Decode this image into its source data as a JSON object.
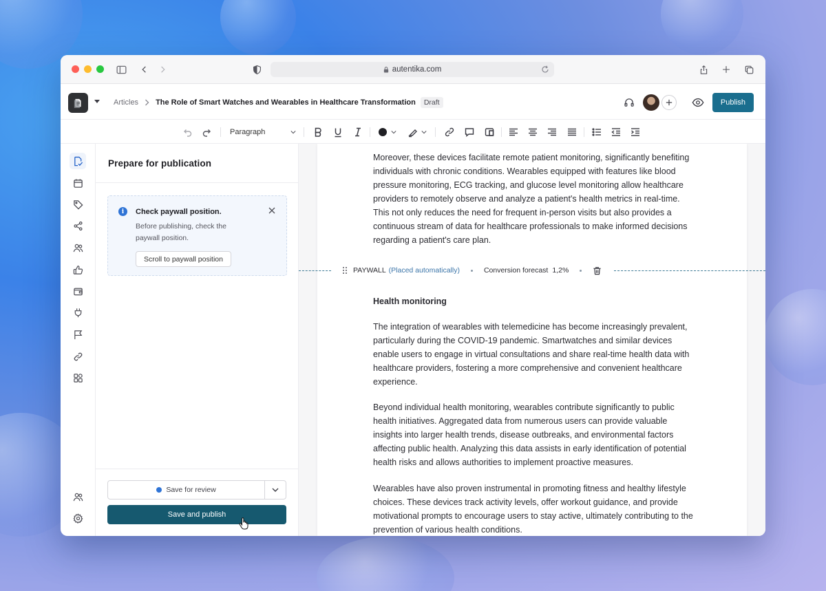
{
  "browser": {
    "url": "autentika.com"
  },
  "header": {
    "breadcrumb_parent": "Articles",
    "article_title": "The Role of Smart Watches and Wearables in Healthcare Transformation",
    "status_badge": "Draft",
    "publish_label": "Publish"
  },
  "toolbar": {
    "block_style": "Paragraph"
  },
  "panel": {
    "title": "Prepare for publication",
    "notice": {
      "title": "Check paywall position.",
      "body": "Before publishing, check the paywall position.",
      "button": "Scroll to paywall position"
    },
    "save_review_label": "Save for review",
    "save_publish_label": "Save and publish"
  },
  "editor": {
    "paragraph_1": "Moreover, these devices facilitate remote patient monitoring, significantly benefiting individuals with chronic conditions. Wearables equipped with features like blood pressure monitoring, ECG tracking, and glucose level monitoring allow healthcare providers to remotely observe and analyze a patient's health metrics in real-time. This not only reduces the need for frequent in-person visits but also provides a continuous stream of data for healthcare professionals to make informed decisions regarding a patient's care plan.",
    "paywall": {
      "label": "PAYWALL",
      "placement": "(Placed automatically)",
      "forecast_label": "Conversion forecast",
      "forecast_value": "1,2%"
    },
    "heading_1": "Health monitoring",
    "paragraph_2": "The integration of wearables with telemedicine has become increasingly prevalent, particularly during the COVID-19 pandemic. Smartwatches and similar devices enable users to engage in virtual consultations and share real-time health data with healthcare providers, fostering a more comprehensive and convenient healthcare experience.",
    "paragraph_3": "Beyond individual health monitoring, wearables contribute significantly to public health initiatives. Aggregated data from numerous users can provide valuable insights into larger health trends, disease outbreaks, and environmental factors affecting public health. Analyzing this data assists in early identification of potential health risks and allows authorities to implement proactive measures.",
    "paragraph_4": "Wearables have also proven instrumental in promoting fitness and healthy lifestyle choices. These devices track activity levels, offer workout guidance, and provide motivational prompts to encourage users to stay active, ultimately contributing to the prevention of various health conditions."
  },
  "colors": {
    "accent": "#1a6e8e",
    "save_publish": "#16596f",
    "info": "#2f74d6"
  }
}
